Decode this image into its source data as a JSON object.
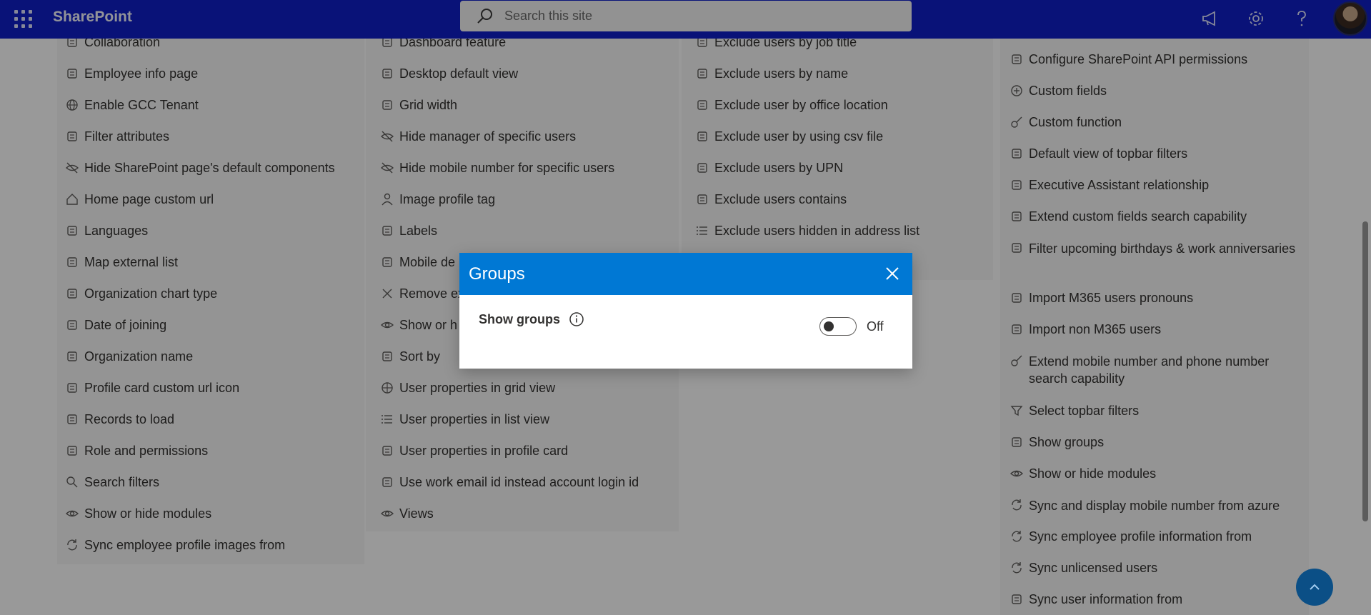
{
  "topbar": {
    "brand": "SharePoint",
    "search_placeholder": "Search this site",
    "icons": [
      "app-launcher-icon",
      "megaphone-icon",
      "gear-icon",
      "help-icon",
      "avatar"
    ]
  },
  "columns": {
    "col1": [
      {
        "label": "Collaboration",
        "icon": "collaboration-icon"
      },
      {
        "label": "Employee info page",
        "icon": "person-page-icon"
      },
      {
        "label": "Enable GCC Tenant",
        "icon": "globe-icon"
      },
      {
        "label": "Filter attributes",
        "icon": "badge-check-icon"
      },
      {
        "label": "Hide SharePoint page's default components",
        "icon": "eye-hide-icon"
      },
      {
        "label": "Home page custom url",
        "icon": "home-icon"
      },
      {
        "label": "Languages",
        "icon": "language-icon"
      },
      {
        "label": "Map external list",
        "icon": "map-list-icon"
      },
      {
        "label": "Organization chart type",
        "icon": "chart-icon"
      },
      {
        "label": "Date of joining",
        "icon": "calendar-icon"
      },
      {
        "label": "Organization name",
        "icon": "org-icon"
      },
      {
        "label": "Profile card custom url icon",
        "icon": "contact-card-icon"
      },
      {
        "label": "Records to load",
        "icon": "checklist-icon"
      },
      {
        "label": "Role and permissions",
        "icon": "badge-check-icon"
      },
      {
        "label": "Search filters",
        "icon": "search-icon"
      },
      {
        "label": "Show or hide modules",
        "icon": "eye-icon"
      },
      {
        "label": "Sync employee profile images from",
        "icon": "sync-icon"
      }
    ],
    "col2": [
      {
        "label": "Dashboard feature",
        "icon": "dashboard-icon"
      },
      {
        "label": "Desktop default view",
        "icon": "desktop-icon"
      },
      {
        "label": "Grid width",
        "icon": "grid-icon"
      },
      {
        "label": "Hide manager of specific users",
        "icon": "eye-hide-icon"
      },
      {
        "label": "Hide mobile number for specific users",
        "icon": "eye-hide-icon"
      },
      {
        "label": "Image profile tag",
        "icon": "person-icon"
      },
      {
        "label": "Labels",
        "icon": "tag-icon"
      },
      {
        "label": "Mobile de",
        "icon": "mobile-icon"
      },
      {
        "label": "Remove ex",
        "icon": "close-icon"
      },
      {
        "label": "Show or h",
        "icon": "eye-icon"
      },
      {
        "label": "Sort by",
        "icon": "sort-icon"
      },
      {
        "label": "User properties in grid view",
        "icon": "grid-view-icon"
      },
      {
        "label": "User properties in list view",
        "icon": "list-view-icon"
      },
      {
        "label": "User properties in profile card",
        "icon": "contact-card-icon"
      },
      {
        "label": "Use work email id instead account login id",
        "icon": "mail-folder-icon"
      },
      {
        "label": "Views",
        "icon": "eye-icon"
      }
    ],
    "col3": [
      {
        "label": "Exclude users by job title",
        "icon": "briefcase-icon"
      },
      {
        "label": "Exclude users by name",
        "icon": "person-search-icon"
      },
      {
        "label": "Exclude user by office location",
        "icon": "building-icon"
      },
      {
        "label": "Exclude user by using csv file",
        "icon": "excel-icon"
      },
      {
        "label": "Exclude users by UPN",
        "icon": "broadcast-icon"
      },
      {
        "label": "Exclude users contains",
        "icon": "folder-search-icon"
      },
      {
        "label": "Exclude users hidden in address list",
        "icon": "list-icon"
      }
    ],
    "col4": [
      {
        "label": "Configure SharePoint API permissions",
        "icon": "cloud-lock-icon"
      },
      {
        "label": "Custom fields",
        "icon": "add-circle-icon"
      },
      {
        "label": "Custom function",
        "icon": "key-icon"
      },
      {
        "label": "Default view of topbar filters",
        "icon": "document-list-icon"
      },
      {
        "label": "Executive Assistant relationship",
        "icon": "people-icon"
      },
      {
        "label": "Extend custom fields search capability",
        "icon": "search-box-icon"
      },
      {
        "label": "Filter upcoming birthdays & work anniversaries",
        "icon": "people-group-icon"
      },
      {
        "label": "Import M365 users pronouns",
        "icon": "contact-icon"
      },
      {
        "label": "Import non M365 users",
        "icon": "arrow-import-icon"
      },
      {
        "label": "Extend mobile number and phone number search capability",
        "icon": "key-icon"
      },
      {
        "label": "Select topbar filters",
        "icon": "filter-icon"
      },
      {
        "label": "Show groups",
        "icon": "people-group-icon"
      },
      {
        "label": "Show or hide modules",
        "icon": "eye-icon"
      },
      {
        "label": "Sync and display mobile number from azure",
        "icon": "sync-icon"
      },
      {
        "label": "Sync employee profile information from",
        "icon": "sync-icon"
      },
      {
        "label": "Sync unlicensed users",
        "icon": "sync-icon"
      },
      {
        "label": "Sync user information from",
        "icon": "person-sync-icon"
      }
    ]
  },
  "dialog": {
    "title": "Groups",
    "setting_label": "Show groups",
    "toggle_state": "Off",
    "toggle_on": false
  },
  "colors": {
    "topbar": "#0f1ec8",
    "dialog_header": "#0078d4",
    "fab": "#0b4f86"
  }
}
